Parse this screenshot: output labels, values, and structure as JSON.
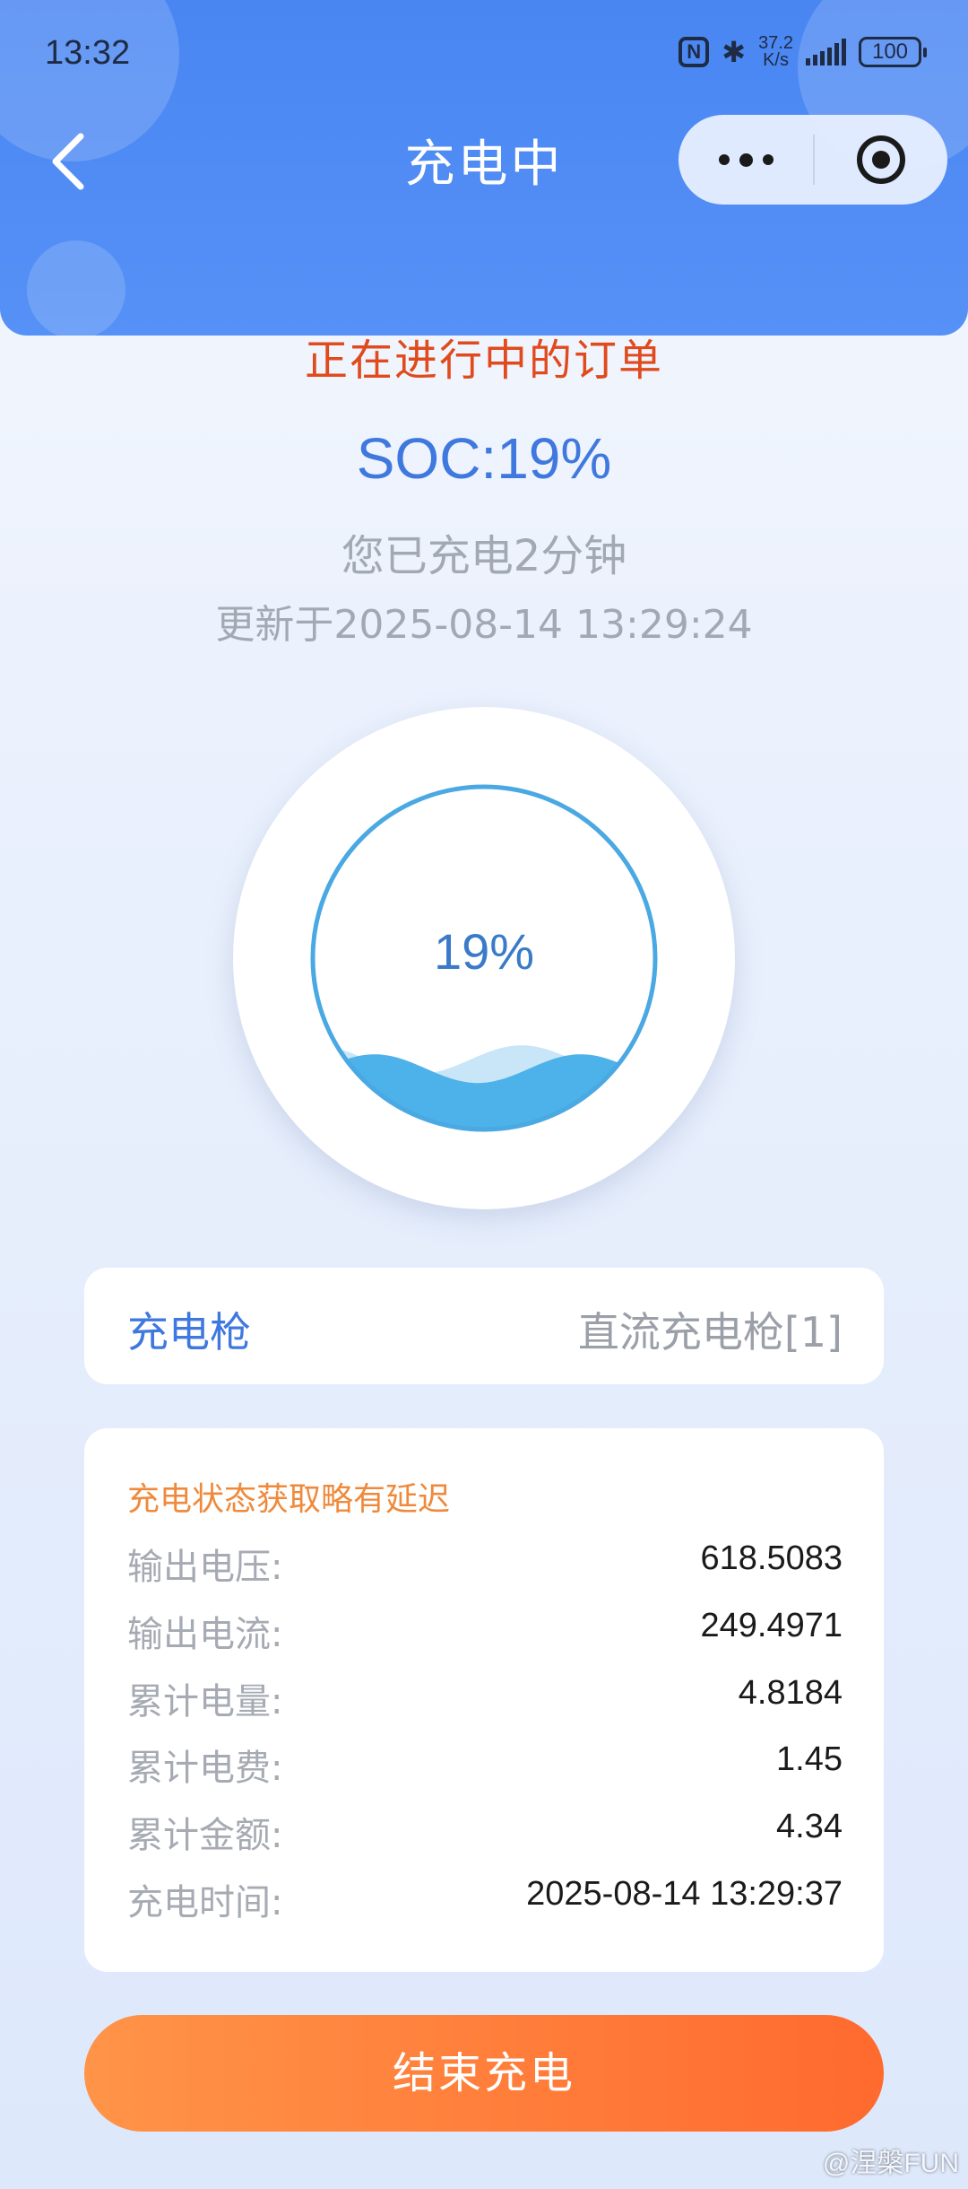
{
  "status_bar": {
    "time": "13:32",
    "nfc": "N",
    "net_speed_value": "37.2",
    "net_speed_unit": "K/s",
    "battery": "100"
  },
  "header": {
    "title": "充电中",
    "more_icon": "more-dots-icon",
    "target_icon": "target-icon"
  },
  "order": {
    "title": "正在进行中的订单",
    "soc_text": "SOC:19%",
    "duration_text": "您已充电2分钟",
    "updated_text": "更新于2025-08-14 13:29:24"
  },
  "gauge": {
    "label": "19%",
    "level": 0.19
  },
  "gun": {
    "label": "充电枪",
    "value": "直流充电枪[1]"
  },
  "details": {
    "notice": "充电状态获取略有延迟",
    "rows": [
      {
        "label": "输出电压:",
        "value": "618.5083"
      },
      {
        "label": "输出电流:",
        "value": "249.4971"
      },
      {
        "label": "累计电量:",
        "value": "4.8184"
      },
      {
        "label": "累计电费:",
        "value": "1.45"
      },
      {
        "label": "累计金额:",
        "value": "4.34"
      },
      {
        "label": "充电时间:",
        "value": "2025-08-14 13:29:37"
      }
    ]
  },
  "end_button": "结束充电",
  "watermark": "@涅槃FUN",
  "colors": {
    "header": "#4a86f2",
    "accent_blue": "#3f78de",
    "order_red": "#e04a1c",
    "notice_orange": "#ef8a3c",
    "button_orange": "#ff7a3a",
    "wave_blue": "#4db1ea"
  }
}
